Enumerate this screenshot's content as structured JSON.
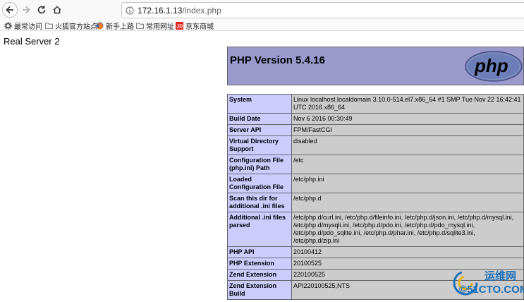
{
  "browser": {
    "url_host": "172.16.1.13",
    "url_path": "/index.php",
    "bookmarks": [
      {
        "label": "最常访问",
        "icon": "gear-icon"
      },
      {
        "label": "火狐官方站点",
        "icon": "folder-icon"
      },
      {
        "label": "新手上路",
        "icon": "firefox-icon"
      },
      {
        "label": "常用网址",
        "icon": "folder-icon"
      },
      {
        "label": "京东商城",
        "icon": "jd-icon"
      }
    ]
  },
  "page": {
    "real_server": "Real Server 2",
    "php_title": "PHP Version 5.4.16",
    "logo_text": "php",
    "rows": [
      {
        "key": "System",
        "value": "Linux localhost.localdomain 3.10.0-514.el7.x86_64 #1 SMP Tue Nov 22 16:42:41 UTC 2016 x86_64"
      },
      {
        "key": "Build Date",
        "value": "Nov 6 2016 00:30:49"
      },
      {
        "key": "Server API",
        "value": "FPM/FastCGI"
      },
      {
        "key": "Virtual Directory Support",
        "value": "disabled"
      },
      {
        "key": "Configuration File (php.ini) Path",
        "value": "/etc"
      },
      {
        "key": "Loaded Configuration File",
        "value": "/etc/php.ini"
      },
      {
        "key": "Scan this dir for additional .ini files",
        "value": "/etc/php.d"
      },
      {
        "key": "Additional .ini files parsed",
        "value": "/etc/php.d/curl.ini, /etc/php.d/fileinfo.ini, /etc/php.d/json.ini, /etc/php.d/mysql.ini, /etc/php.d/mysqli.ini, /etc/php.d/pdo.ini, /etc/php.d/pdo_mysql.ini, /etc/php.d/pdo_sqlite.ini, /etc/php.d/phar.ini, /etc/php.d/sqlite3.ini, /etc/php.d/zip.ini"
      },
      {
        "key": "PHP API",
        "value": "20100412"
      },
      {
        "key": "PHP Extension",
        "value": "20100525"
      },
      {
        "key": "Zend Extension",
        "value": "220100525"
      },
      {
        "key": "Zend Extension Build",
        "value": "API220100525,NTS"
      }
    ]
  },
  "watermark": {
    "line1": "运维网",
    "line2": "©51CTO.COM"
  },
  "colors": {
    "header_bg": "#9999cc",
    "key_bg": "#ccccff",
    "value_bg": "#cccccc"
  }
}
